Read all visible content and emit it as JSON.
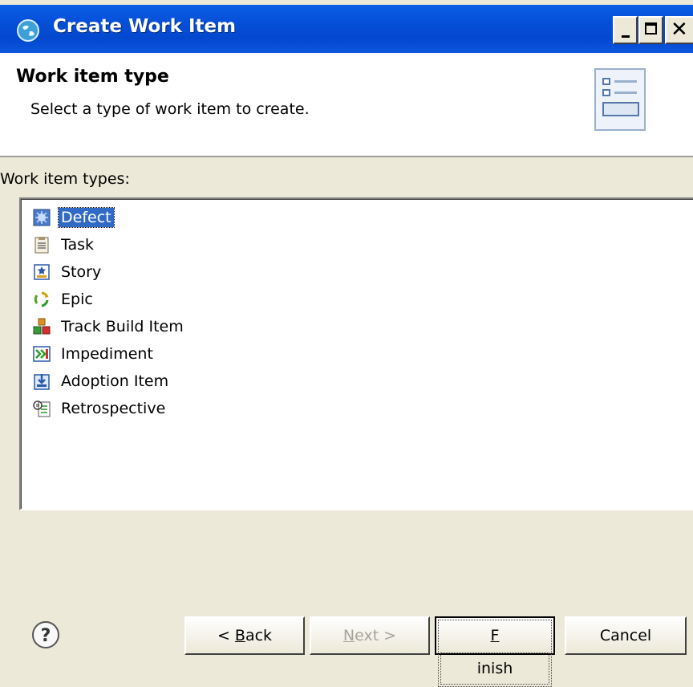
{
  "window": {
    "title": "Create Work Item",
    "controls": {
      "minimize": "_",
      "maximize": "□",
      "close": "×"
    }
  },
  "header": {
    "title": "Work item type",
    "description": "Select a type of work item to create.",
    "icon": "wizard-banner-icon"
  },
  "list": {
    "label": "Work item types:",
    "selected": "Defect",
    "items": [
      {
        "label": "Defect",
        "icon": "defect-icon"
      },
      {
        "label": "Task",
        "icon": "task-icon"
      },
      {
        "label": "Story",
        "icon": "story-icon"
      },
      {
        "label": "Epic",
        "icon": "epic-icon"
      },
      {
        "label": "Track Build Item",
        "icon": "track-build-item-icon"
      },
      {
        "label": "Impediment",
        "icon": "impediment-icon"
      },
      {
        "label": "Adoption Item",
        "icon": "adoption-item-icon"
      },
      {
        "label": "Retrospective",
        "icon": "retrospective-icon"
      }
    ]
  },
  "buttons": {
    "help": "?",
    "back": {
      "prefix": "< ",
      "mnemonic": "B",
      "rest": "ack"
    },
    "next": {
      "mnemonic": "N",
      "rest": "ext >",
      "enabled": false
    },
    "finish": {
      "mnemonic": "F",
      "rest": "inish"
    },
    "cancel": "Cancel"
  },
  "colors": {
    "titlebar": "#0550d8",
    "selection": "#316ac5",
    "dialog_bg": "#ece9d8"
  }
}
